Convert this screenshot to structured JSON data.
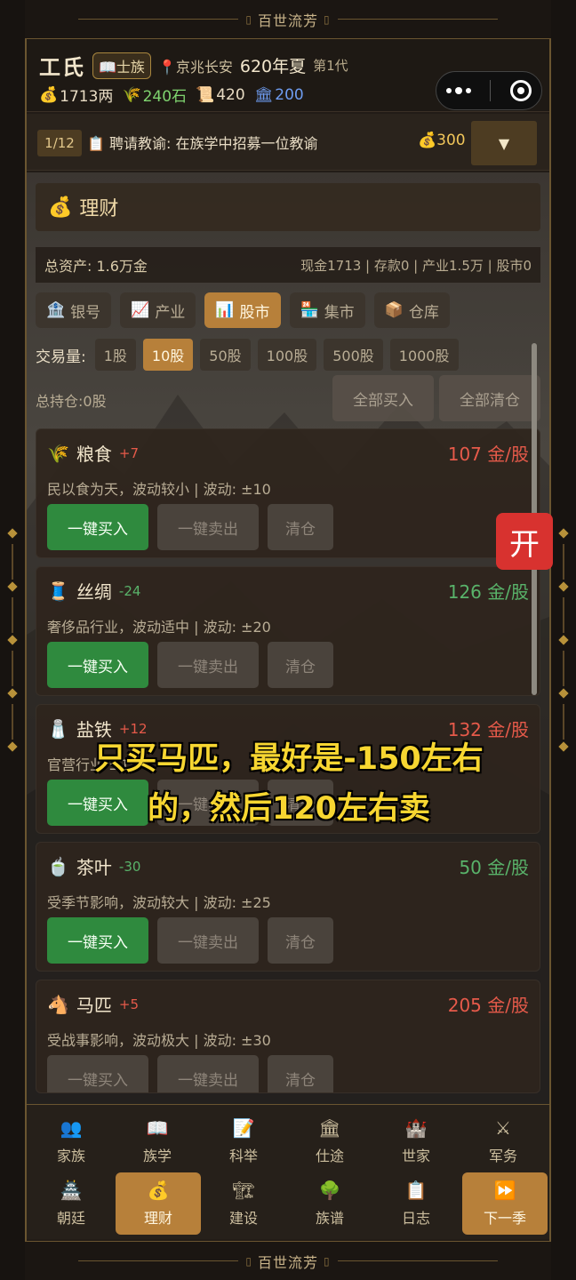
{
  "banner": {
    "title": "百世流芳"
  },
  "header": {
    "clan_name": "工氏",
    "rank": "士族",
    "location": "京兆长安",
    "year": "620年夏",
    "generation": "第1代",
    "resources": [
      {
        "icon": "money-bag-icon",
        "value": "1713两",
        "color": "#e8dcc4"
      },
      {
        "icon": "grain-icon",
        "value": "240石",
        "color": "#7fd46f"
      },
      {
        "icon": "scroll-icon",
        "value": "420",
        "color": "#e8dcc4"
      },
      {
        "icon": "government-icon",
        "value": "200",
        "color": "#6e9cf0"
      }
    ]
  },
  "task": {
    "count": "1/12",
    "text": "聘请教谕: 在族学中招募一位教谕",
    "cost": "300",
    "dropdown": "▼"
  },
  "panel": {
    "title": "理财",
    "total_assets": "总资产: 1.6万金",
    "breakdown": "现金1713 | 存款0 | 产业1.5万 | 股市0"
  },
  "tabs": [
    {
      "label": "银号",
      "icon": "bank-icon",
      "active": false
    },
    {
      "label": "产业",
      "icon": "chart-up-icon",
      "active": false
    },
    {
      "label": "股市",
      "icon": "bar-chart-icon",
      "active": true
    },
    {
      "label": "集市",
      "icon": "market-icon",
      "active": false
    },
    {
      "label": "仓库",
      "icon": "box-icon",
      "active": false
    }
  ],
  "trade": {
    "label": "交易量:",
    "amounts": [
      "1股",
      "10股",
      "50股",
      "100股",
      "500股",
      "1000股"
    ],
    "selected": "10股"
  },
  "holdings": {
    "text": "总持仓:0股",
    "buy_all": "全部买入",
    "clear_all": "全部清仓"
  },
  "stocks": [
    {
      "name": "粮食",
      "change": "+7",
      "price": "107 金/股",
      "desc": "民以食为天，波动较小  |  波动: ±10",
      "icon": "wheat-icon",
      "trend": "up",
      "buy": "一键买入",
      "sell": "一键卖出",
      "clear": "清仓",
      "buy_enabled": true
    },
    {
      "name": "丝绸",
      "change": "-24",
      "price": "126 金/股",
      "desc": "奢侈品行业，波动适中  |  波动: ±20",
      "icon": "thread-spool-icon",
      "trend": "down",
      "buy": "一键买入",
      "sell": "一键卖出",
      "clear": "清仓",
      "buy_enabled": true
    },
    {
      "name": "盐铁",
      "change": "+12",
      "price": "132 金/股",
      "desc": "官营行业                    ±15",
      "icon": "salt-icon",
      "trend": "up",
      "buy": "一键买入",
      "sell": "一键卖出",
      "clear": "清仓",
      "buy_enabled": true
    },
    {
      "name": "茶叶",
      "change": "-30",
      "price": "50 金/股",
      "desc": "受季节影响，波动较大  |  波动: ±25",
      "icon": "tea-icon",
      "trend": "down",
      "buy": "一键买入",
      "sell": "一键卖出",
      "clear": "清仓",
      "buy_enabled": true
    },
    {
      "name": "马匹",
      "change": "+5",
      "price": "205 金/股",
      "desc": "受战事影响，波动极大  |  波动: ±30",
      "icon": "horse-icon",
      "trend": "up",
      "buy": "一键买入",
      "sell": "一键卖出",
      "clear": "清仓",
      "buy_enabled": false
    }
  ],
  "open_button": "开",
  "overlay_caption": "只买马匹，最好是-150左右的，然后120左右卖",
  "nav": {
    "row1": [
      {
        "label": "家族",
        "icon": "family-icon",
        "color": "#6e9cf0"
      },
      {
        "label": "族学",
        "icon": "book-icon",
        "color": "#d8d4cc"
      },
      {
        "label": "科举",
        "icon": "memo-icon",
        "color": "#e8c66a"
      },
      {
        "label": "仕途",
        "icon": "government-icon",
        "color": "#d8d4cc"
      },
      {
        "label": "世家",
        "icon": "castle-icon",
        "color": "#8fa8c8"
      },
      {
        "label": "军务",
        "icon": "crossed-swords-icon",
        "color": "#d8d4cc"
      }
    ],
    "row2": [
      {
        "label": "朝廷",
        "icon": "pagoda-icon",
        "color": "#d8d4cc",
        "active": false
      },
      {
        "label": "理财",
        "icon": "money-bag-icon",
        "color": "#e8c66a",
        "active": true
      },
      {
        "label": "建设",
        "icon": "crane-icon",
        "color": "#d04a3a",
        "active": false
      },
      {
        "label": "族谱",
        "icon": "tree-icon",
        "color": "#59b36a",
        "active": false
      },
      {
        "label": "日志",
        "icon": "clipboard-icon",
        "color": "#d8d4cc",
        "active": false
      },
      {
        "label": "下一季",
        "icon": "fast-forward-icon",
        "color": "#4a8ae0",
        "active": true
      }
    ]
  },
  "colors": {
    "accent": "#b7803a",
    "buy_green": "#2f8a3e",
    "price_up": "#e65a4a",
    "price_down": "#59b36a"
  }
}
